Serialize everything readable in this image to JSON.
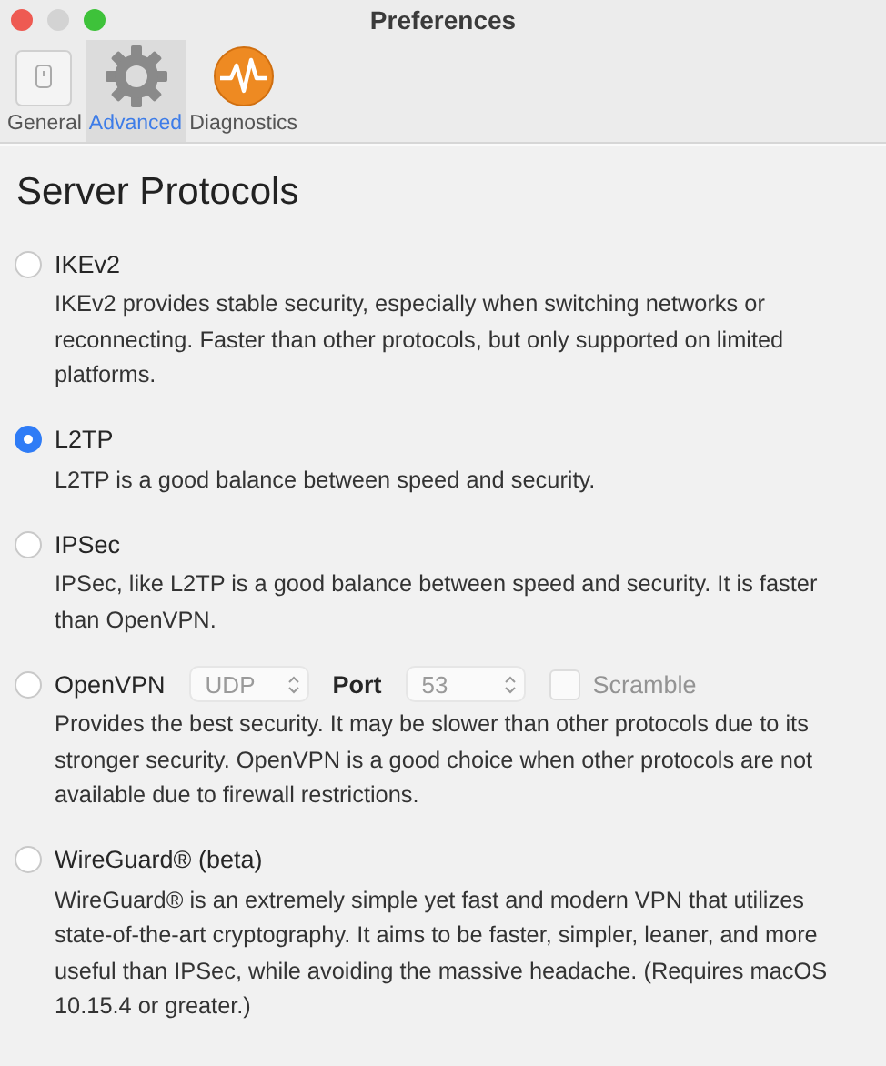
{
  "window": {
    "title": "Preferences"
  },
  "tabs": [
    {
      "label": "General",
      "kind": "general",
      "selected": false
    },
    {
      "label": "Advanced",
      "kind": "advanced",
      "selected": true
    },
    {
      "label": "Diagnostics",
      "kind": "diagnostics",
      "selected": false
    }
  ],
  "heading": "Server Protocols",
  "protocols": [
    {
      "name": "IKEv2",
      "selected": false,
      "description": "IKEv2 provides stable security, especially when switching networks or reconnecting. Faster than other protocols, but only supported on limited platforms."
    },
    {
      "name": "L2TP",
      "selected": true,
      "description": "L2TP is a good balance between speed and security."
    },
    {
      "name": "IPSec",
      "selected": false,
      "description": "IPSec, like L2TP is a good balance between speed and security. It is faster than OpenVPN."
    },
    {
      "name": "OpenVPN",
      "selected": false,
      "description": "Provides the best security. It may be slower than other protocols due to its stronger security. OpenVPN is a good choice when other protocols are not available due to firewall restrictions.",
      "options": {
        "disabled": true,
        "transport": "UDP",
        "port_label": "Port",
        "port": "53",
        "scramble": {
          "label": "Scramble",
          "checked": false
        }
      }
    },
    {
      "name": "WireGuard® (beta)",
      "selected": false,
      "description": "WireGuard® is an extremely simple yet fast and modern VPN that utilizes state-of-the-art cryptography. It aims to be faster, simpler, leaner, and more useful than IPSec, while avoiding the massive headache. (Requires macOS 10.15.4 or greater.)"
    }
  ]
}
